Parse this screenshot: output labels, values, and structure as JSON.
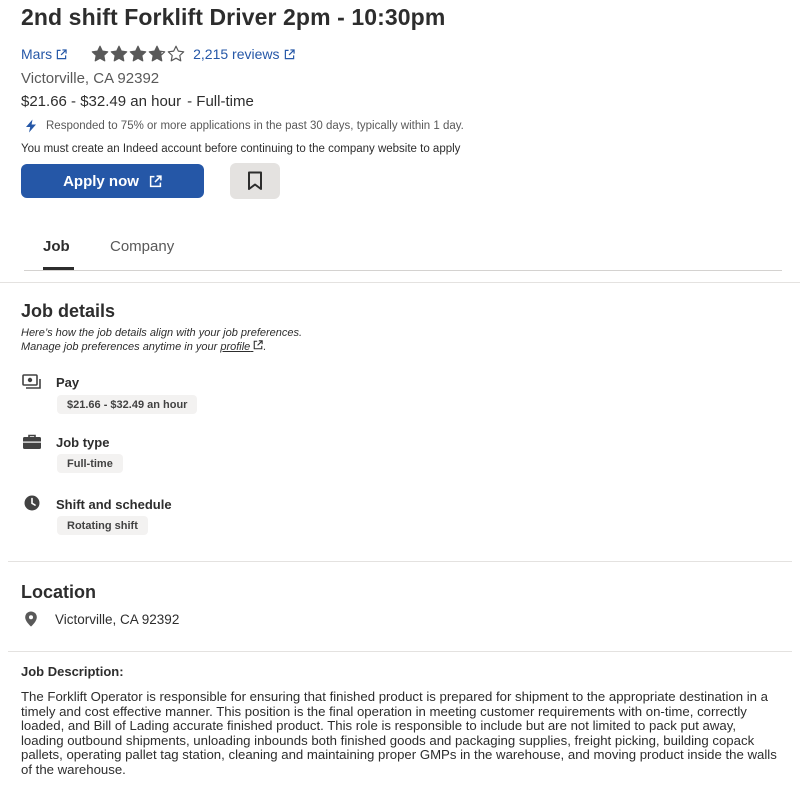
{
  "job": {
    "title": "2nd shift Forklift Driver 2pm - 10:30pm",
    "company": "Mars",
    "rating": 3.8,
    "reviews_label": "2,215 reviews",
    "location": "Victorville, CA 92392",
    "salary": "$21.66 - $32.49 an hour",
    "job_type_suffix": "- Full-time",
    "responded_text": "Responded to 75% or more applications in the past 30 days, typically within 1 day.",
    "account_notice": "You must create an Indeed account before continuing to the company website to apply",
    "apply_label": "Apply now"
  },
  "tabs": [
    {
      "label": "Job",
      "active": true
    },
    {
      "label": "Company",
      "active": false
    }
  ],
  "job_details": {
    "heading": "Job details",
    "note_line1": "Here’s how the job details align with your job preferences.",
    "note_line2_prefix": "Manage job preferences anytime in your",
    "note_link": "profile",
    "note_suffix": ".",
    "items": [
      {
        "icon": "money-icon",
        "label": "Pay",
        "value": "$21.66 - $32.49 an hour"
      },
      {
        "icon": "briefcase-icon",
        "label": "Job type",
        "value": "Full-time"
      },
      {
        "icon": "clock-icon",
        "label": "Shift and schedule",
        "value": "Rotating shift"
      }
    ]
  },
  "location_section": {
    "heading": "Location",
    "value": "Victorville, CA 92392"
  },
  "description": {
    "heading": "Job Description:",
    "body": "The Forklift Operator is responsible for ensuring that finished product is prepared for shipment to the appropriate destination in a timely and cost effective manner. This position is the final operation in meeting customer requirements with on-time, correctly loaded, and Bill of Lading accurate finished product. This role is responsible to include but are not limited to pack put away, loading outbound shipments, unloading inbounds both finished goods and packaging supplies, freight picking, building copack pallets, operating pallet tag station, cleaning and maintaining proper GMPs in the warehouse, and moving product inside the walls of the warehouse."
  },
  "colors": {
    "link_blue": "#2557a7",
    "text_dark": "#2d2d2d",
    "text_muted": "#595959",
    "pill_bg": "#f3f2f1"
  }
}
